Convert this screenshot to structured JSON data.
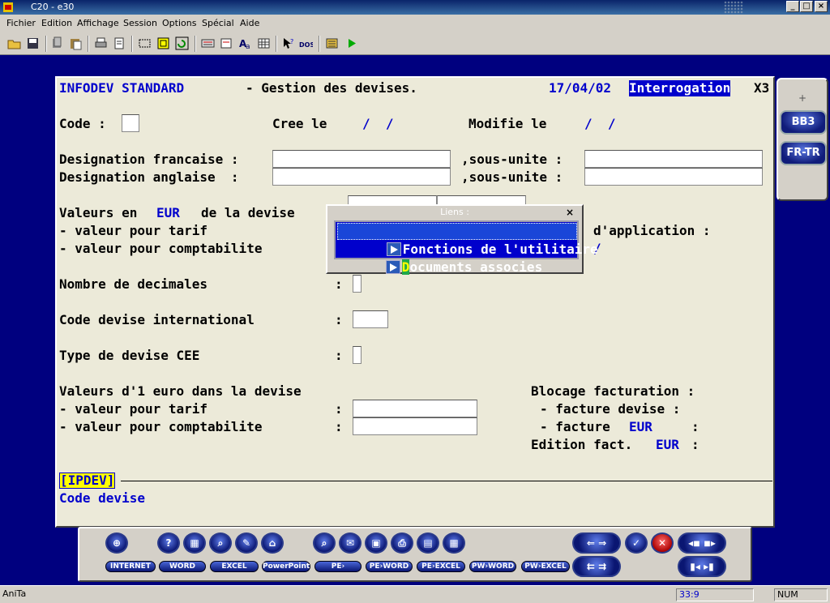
{
  "window": {
    "title": "C20 - e30",
    "btn_min": "_",
    "btn_max": "□",
    "btn_close": "×"
  },
  "menu": [
    "Fichier",
    "Edition",
    "Affichage",
    "Session",
    "Options",
    "Spécial",
    "Aide"
  ],
  "toolbar_icons": [
    "open-folder-icon",
    "save-icon",
    "cut-icon",
    "paste-icon",
    "print-icon",
    "print-preview-icon",
    "rectangle-select-icon",
    "frame-icon",
    "refresh-icon",
    "keyboard-icon",
    "edit-icon",
    "font-icon",
    "grid-icon",
    "pointer-help-icon",
    "dos-icon",
    "macro-icon",
    "play-icon"
  ],
  "form": {
    "app": "INFODEV STANDARD",
    "screen_title": "- Gestion des devises.",
    "date": "17/04/02",
    "mode": "Interrogation",
    "mode_code": "X3",
    "code_label": "Code :",
    "cree_label": "Cree le",
    "cree_value": "/  /",
    "modifie_label": "Modifie le",
    "modifie_value": "/  /",
    "des_fr_label": "Designation francaise :",
    "des_en_label": "Designation anglaise  :",
    "sous_unite": ",sous-unite :",
    "valeurs_en": "Valeurs en",
    "eur": "EUR",
    "de_la_devise": "de la devise",
    "valeur_tarif": "- valeur pour tarif",
    "valeur_compta": "- valeur pour comptabilite",
    "date_application": "d'application :",
    "slash": "/",
    "nb_decimales": "Nombre de decimales",
    "code_intl": "Code devise international",
    "type_cee": "Type de devise CEE",
    "colon": ":",
    "valeurs_euro": "Valeurs d'1 euro dans la devise",
    "blocage": "Blocage facturation :",
    "facture_devise": "- facture devise :",
    "facture_eur_pre": "- facture",
    "facture_eur_colon": ":",
    "edition_fact": "Edition fact.",
    "edition_colon": ":",
    "screen_code": "[IPDEV]",
    "help_line": "Code devise"
  },
  "popup": {
    "title": "Liens :",
    "close": "×",
    "items": [
      "Fonctions de l'utilitaire",
      "Documents associes"
    ]
  },
  "side_panel": {
    "plus": "+",
    "btn1": "BB3",
    "btn2": "FR-TR"
  },
  "bottom_buttons": [
    "INTERNET",
    "WORD",
    "EXCEL",
    "PowerPoint",
    "PE›",
    "PE›WORD",
    "PE›EXCEL",
    "PW›WORD",
    "PW›EXCEL"
  ],
  "statusbar": {
    "user": "AniTa",
    "position": "33:9",
    "num": "NUM"
  }
}
